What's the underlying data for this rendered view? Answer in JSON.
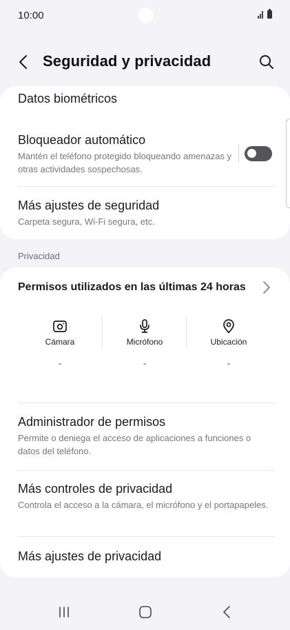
{
  "status_bar": {
    "time": "10:00"
  },
  "header": {
    "title": "Seguridad y privacidad"
  },
  "card_security": {
    "biometrics": {
      "title": "Datos biométricos"
    },
    "auto_blocker": {
      "title": "Bloqueador automático",
      "subtitle": "Mantén el teléfono protegido bloqueando amenazas y otras actividades sospechosas.",
      "enabled": false
    },
    "more_security": {
      "title": "Más ajustes de seguridad",
      "subtitle": "Carpeta segura, Wi-Fi segura, etc."
    }
  },
  "privacy_section_label": "Privacidad",
  "card_privacy": {
    "permissions_header": "Permisos utilizados en las últimas 24 horas",
    "permissions": [
      {
        "label": "Cámara",
        "value": "-",
        "icon": "camera-icon"
      },
      {
        "label": "Micrófono",
        "value": "-",
        "icon": "microphone-icon"
      },
      {
        "label": "Ubicación",
        "value": "-",
        "icon": "location-icon"
      }
    ],
    "permission_manager": {
      "title": "Administrador de permisos",
      "subtitle": "Permite o deniega el acceso de aplicaciones a funciones o datos del teléfono."
    },
    "more_privacy_controls": {
      "title": "Más controles de privacidad",
      "subtitle": "Controla el acceso a la cámara, el micrófono y el portapapeles."
    },
    "more_privacy_settings": {
      "title": "Más ajustes de privacidad"
    }
  },
  "navbar": {
    "icons": [
      "recents-icon",
      "home-icon",
      "back-icon"
    ]
  }
}
